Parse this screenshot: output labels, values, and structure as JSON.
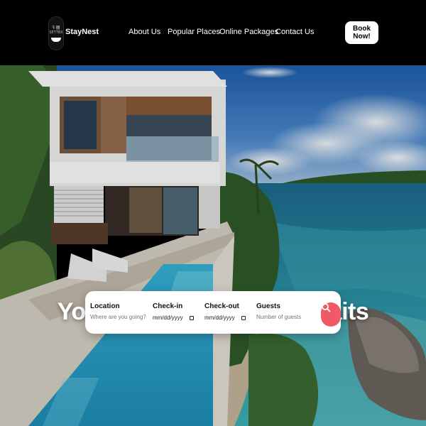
{
  "header": {
    "logo": {
      "mark": "ꟻ 丽",
      "mark_sub": "SETTBX"
    },
    "brand": "StayNest",
    "nav": [
      "About Us",
      "Popular Places",
      "Online Packages",
      "Contact Us"
    ],
    "cta": "Book Now!"
  },
  "hero": {
    "title": "Your Next Adventure Awaits"
  },
  "search": {
    "location": {
      "label": "Location",
      "placeholder": "Where are you going?"
    },
    "checkin": {
      "label": "Check-in",
      "value": "mm/dd/yyyy"
    },
    "checkout": {
      "label": "Check-out",
      "value": "mm/dd/yyyy"
    },
    "guests": {
      "label": "Guests",
      "placeholder": "Number of guests"
    },
    "button_icon": "search-icon"
  },
  "colors": {
    "accent": "#f05a66",
    "header_bg": "#000000"
  }
}
